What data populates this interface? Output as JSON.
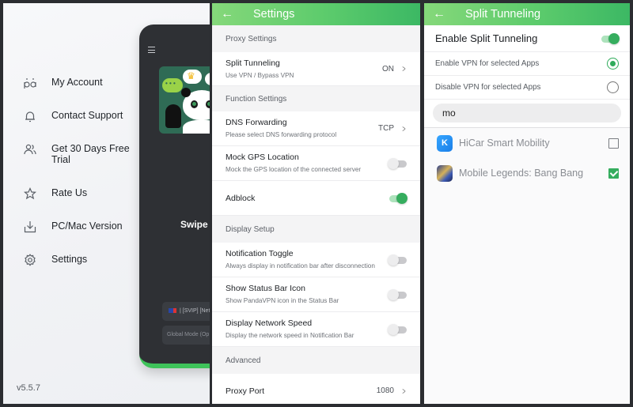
{
  "drawer": {
    "menu": [
      {
        "label": "My Account",
        "icon": "account-icon"
      },
      {
        "label": "Contact Support",
        "icon": "bell-icon"
      },
      {
        "label": "Get 30 Days Free Trial",
        "icon": "users-icon"
      },
      {
        "label": "Rate Us",
        "icon": "star-icon"
      },
      {
        "label": "PC/Mac Version",
        "icon": "download-icon"
      },
      {
        "label": "Settings",
        "icon": "gear-icon"
      }
    ],
    "version": "v5.5.7",
    "background_app": {
      "swipe_text": "Swipe u",
      "server_text": "| [SVIP] [Net",
      "mode_text": "Global Mode (Op",
      "accent_color": "#3ec35a"
    }
  },
  "settings": {
    "title": "Settings",
    "back_icon": "arrow-left-icon",
    "sections": {
      "proxy": "Proxy Settings",
      "function": "Function Settings",
      "display": "Display Setup",
      "advanced": "Advanced"
    },
    "split_tunneling": {
      "title": "Split Tunneling",
      "subtitle": "Use VPN / Bypass VPN",
      "value": "ON"
    },
    "dns_forwarding": {
      "title": "DNS Forwarding",
      "subtitle": "Please select DNS forwarding protocol",
      "value": "TCP"
    },
    "mock_gps": {
      "title": "Mock GPS Location",
      "subtitle": "Mock the GPS location of the connected server",
      "enabled": false
    },
    "adblock": {
      "title": "Adblock",
      "enabled": true
    },
    "notification_toggle": {
      "title": "Notification Toggle",
      "subtitle": "Always display in notification bar after disconnection",
      "enabled": false
    },
    "status_bar_icon": {
      "title": "Show Status Bar Icon",
      "subtitle": "Show PandaVPN icon in the Status Bar",
      "enabled": false
    },
    "network_speed": {
      "title": "Display Network Speed",
      "subtitle": "Display the network speed in Notification Bar",
      "enabled": false
    },
    "proxy_port": {
      "title": "Proxy Port",
      "value": "1080"
    },
    "accent_color": "#35ad5e"
  },
  "split": {
    "title": "Split Tunneling",
    "enable_label": "Enable Split Tunneling",
    "enable_on": true,
    "options": [
      {
        "label": "Enable VPN for selected Apps",
        "selected": true
      },
      {
        "label": "Disable VPN for selected Apps",
        "selected": false
      }
    ],
    "search_value": "mo",
    "apps": [
      {
        "name": "HiCar Smart Mobility",
        "checked": false,
        "icon_text": "K"
      },
      {
        "name": "Mobile Legends: Bang Bang",
        "checked": true
      }
    ]
  }
}
